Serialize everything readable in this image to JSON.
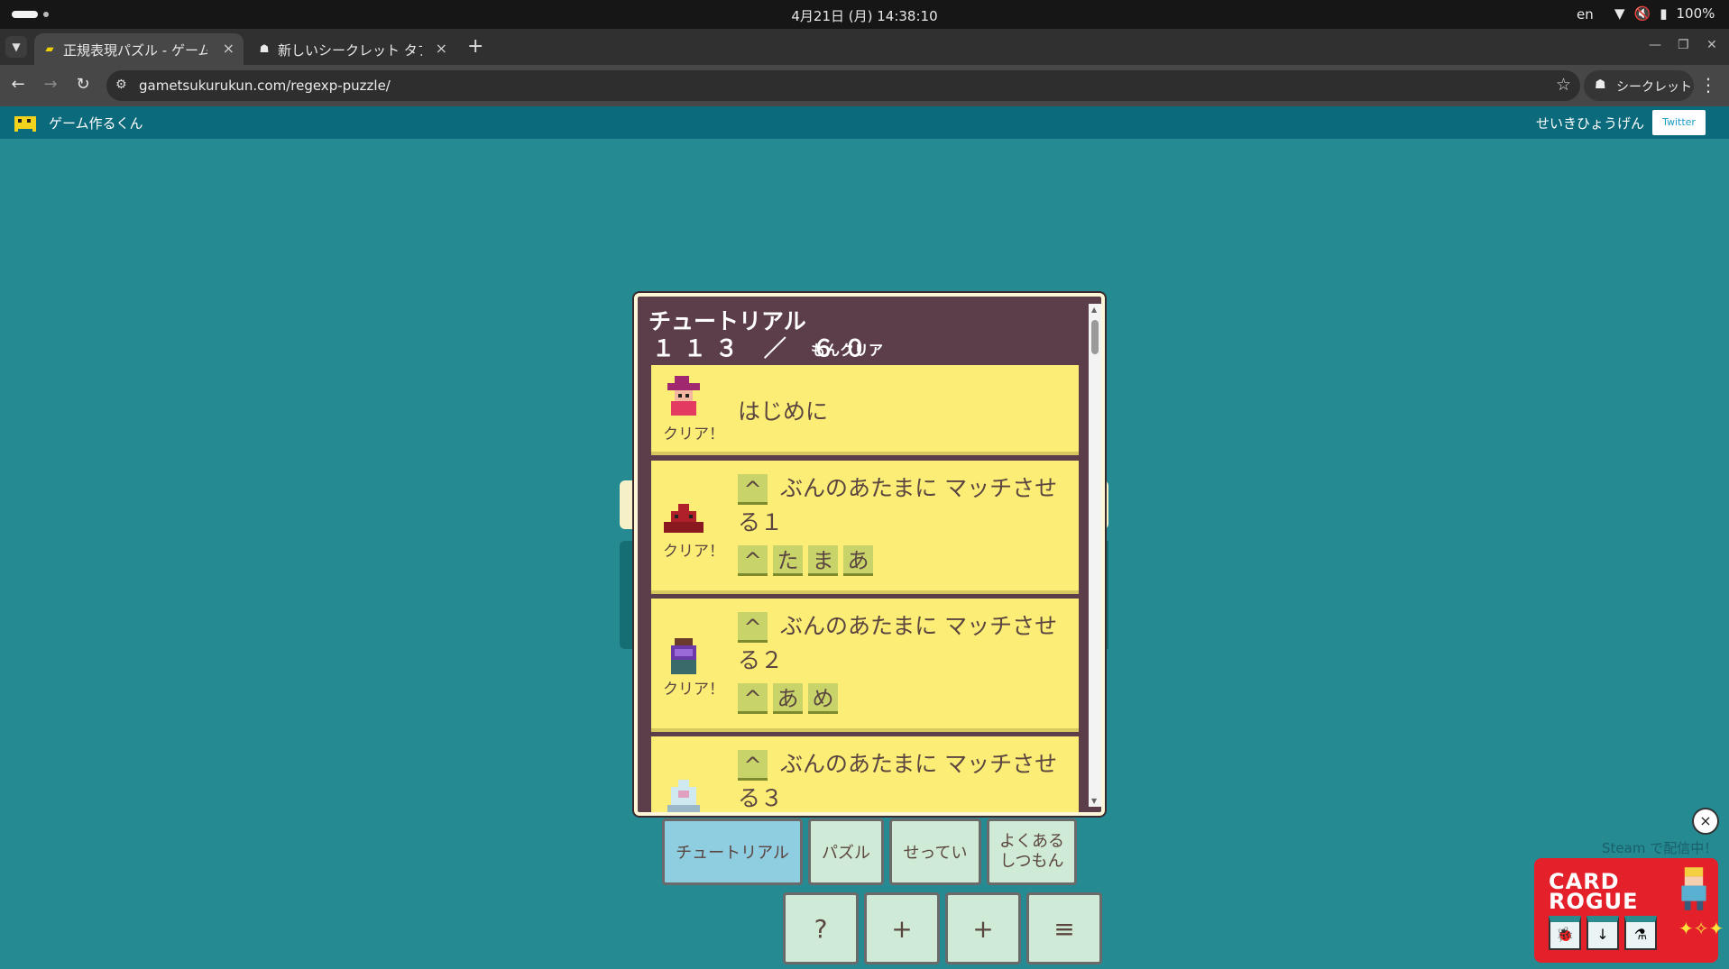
{
  "os_bar": {
    "datetime": "4月21日 (月)  14:38:10",
    "language": "en",
    "battery": "100%"
  },
  "browser": {
    "tabs": [
      {
        "label": "正規表現パズル - ゲーム作",
        "active": true
      },
      {
        "label": "新しいシークレット タブ",
        "active": false
      }
    ],
    "new_tab": "+",
    "url": "gametsukurukun.com/regexp-puzzle/",
    "incognito_label": "シークレット"
  },
  "site_header": {
    "brand": "ゲーム作るくん",
    "regex_link": "せいきひょうげん",
    "twitter": "Twitter"
  },
  "panel": {
    "title": "チュートリアル",
    "progress_numbers": "１１３ ／ ６０",
    "progress_suffix": "もんクリア",
    "items": [
      {
        "title": "はじめに",
        "status": "クリア！"
      },
      {
        "question_tile": "^",
        "question_line1": "ぶんのあたまに マッチさせ",
        "question_line2": "る１",
        "tiles": [
          "^",
          "た",
          "ま",
          "あ"
        ],
        "status": "クリア！"
      },
      {
        "question_tile": "^",
        "question_line1": "ぶんのあたまに マッチさせ",
        "question_line2": "る２",
        "tiles": [
          "^",
          "あ",
          "め"
        ],
        "status": "クリア！"
      },
      {
        "question_tile": "^",
        "question_line1": "ぶんのあたまに マッチさせ",
        "question_line2": "る３"
      }
    ]
  },
  "tab_buttons": {
    "tutorial": "チュートリアル",
    "puzzle": "パズル",
    "settings": "せってい",
    "faq_line1": "よくある",
    "faq_line2": "しつもん"
  },
  "action_buttons": {
    "help": "?",
    "add1": "+",
    "add2": "+",
    "menu": "≡"
  },
  "ad": {
    "caption": "Steam で配信中！",
    "title_line1": "CARD",
    "title_line2": "ROGUE",
    "close": "×"
  },
  "colors": {
    "background": "#258a92",
    "card": "#fbed75",
    "panel": "#5c3e4a",
    "header": "#0b6a7c"
  }
}
